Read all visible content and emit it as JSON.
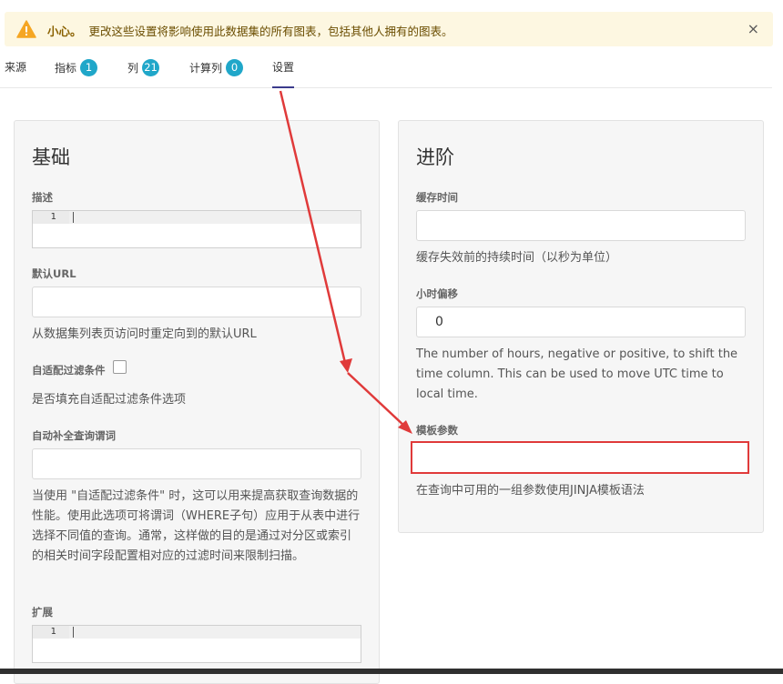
{
  "warning": {
    "title": "小心。",
    "message": "更改这些设置将影响使用此数据集的所有图表，包括其他人拥有的图表。",
    "close_symbol": "×"
  },
  "tabs": [
    {
      "label": "来源"
    },
    {
      "label": "指标",
      "count": "1"
    },
    {
      "label": "列",
      "count": "21"
    },
    {
      "label": "计算列",
      "count": "0"
    },
    {
      "label": "设置",
      "active": true
    }
  ],
  "basic": {
    "title": "基础",
    "description_label": "描述",
    "code_line_number": "1",
    "default_url_label": "默认URL",
    "default_url_value": "",
    "default_url_help": "从数据集列表页访问时重定向到的默认URL",
    "auto_filter_label": "自适配过滤条件",
    "auto_filter_help": "是否填充自适配过滤条件选项",
    "autocomplete_label": "自动补全查询谓词",
    "autocomplete_value": "",
    "autocomplete_help": "当使用 \"自适配过滤条件\" 时，这可以用来提高获取查询数据的性能。使用此选项可将谓词（WHERE子句）应用于从表中进行选择不同值的查询。通常，这样做的目的是通过对分区或索引的相关时间字段配置相对应的过滤时间来限制扫描。",
    "extension_label": "扩展",
    "extension_line_number": "1"
  },
  "advanced": {
    "title": "进阶",
    "cache_timeout_label": "缓存时间",
    "cache_timeout_value": "",
    "cache_timeout_help": "缓存失效前的持续时间（以秒为单位）",
    "hours_offset_label": "小时偏移",
    "hours_offset_value": "0",
    "hours_offset_help": "The number of hours, negative or positive, to shift the time column. This can be used to move UTC time to local time.",
    "template_params_label": "模板参数",
    "template_params_value": "",
    "template_params_help": "在查询中可用的一组参数使用JINJA模板语法"
  },
  "colors": {
    "badge": "#20a7c9",
    "highlight": "#e03a3a",
    "warning_bg": "#fdf7e1",
    "warning_icon": "#f5a623"
  }
}
